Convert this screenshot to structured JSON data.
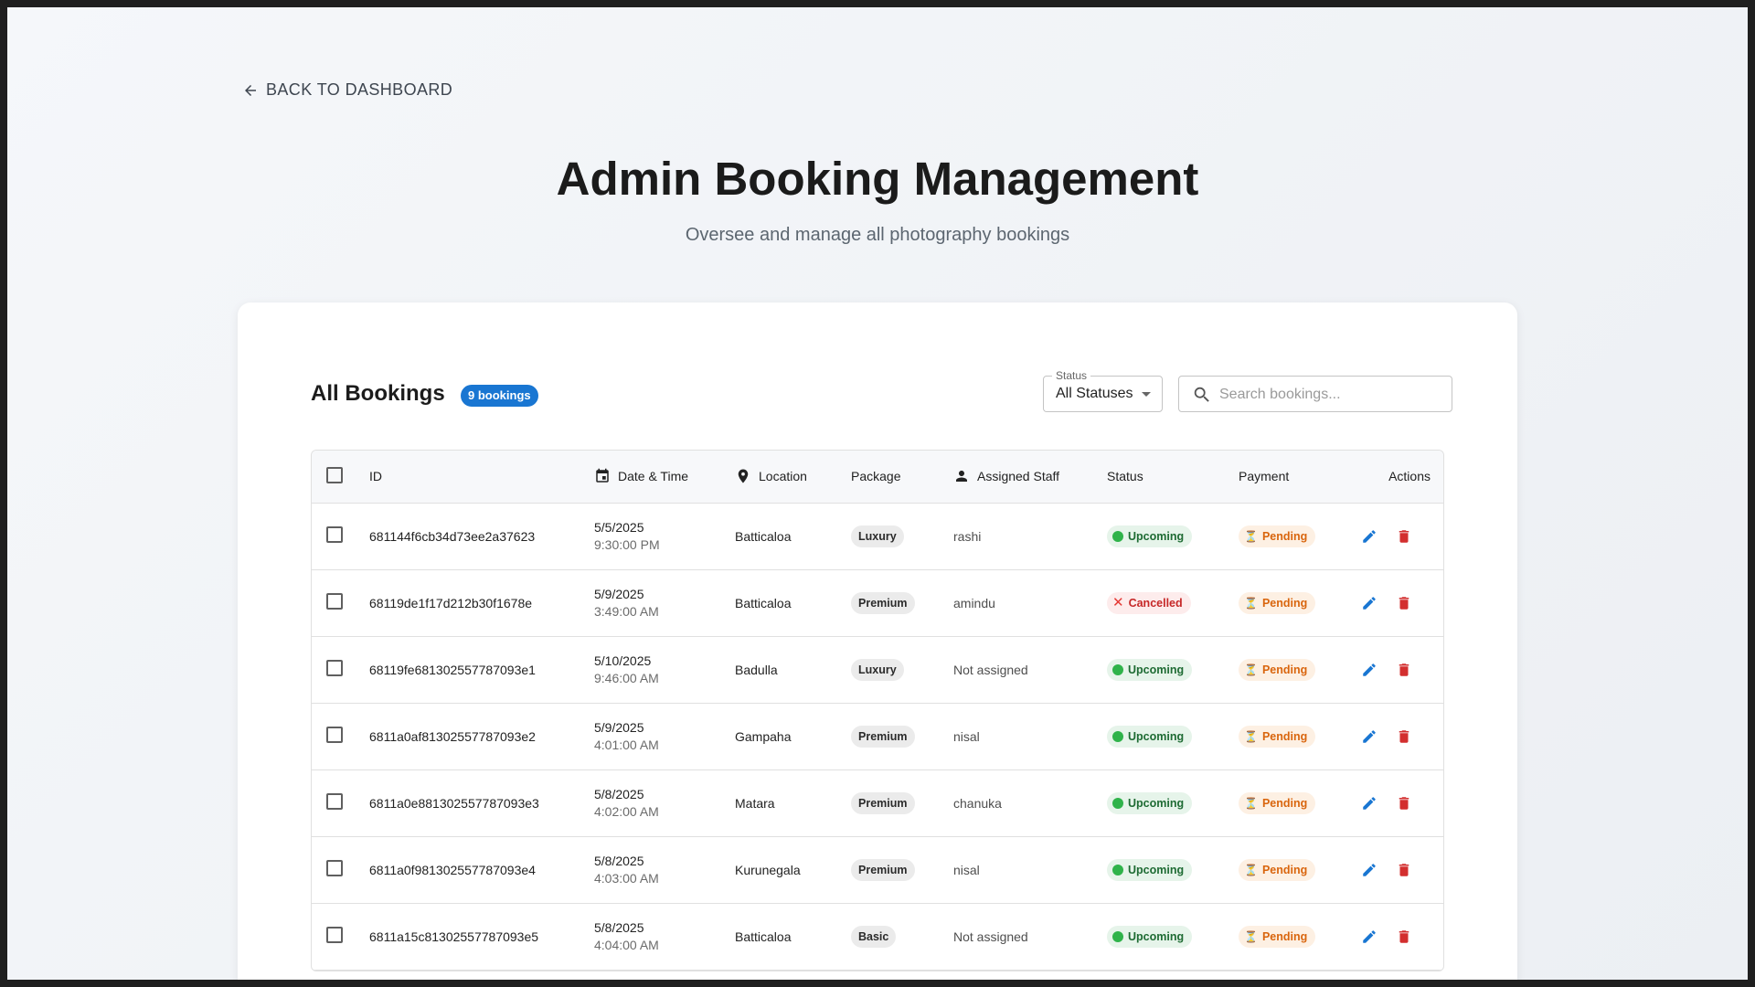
{
  "nav": {
    "back_label": "BACK TO DASHBOARD"
  },
  "header": {
    "title": "Admin Booking Management",
    "subtitle": "Oversee and manage all photography bookings"
  },
  "card": {
    "title": "All Bookings",
    "count_badge": "9 bookings",
    "status_filter": {
      "label": "Status",
      "value": "All Statuses"
    },
    "search": {
      "placeholder": "Search bookings..."
    }
  },
  "table": {
    "columns": {
      "id": "ID",
      "datetime": "Date & Time",
      "location": "Location",
      "package": "Package",
      "staff": "Assigned Staff",
      "status": "Status",
      "payment": "Payment",
      "actions": "Actions"
    },
    "rows": [
      {
        "id": "681144f6cb34d73ee2a37623",
        "date": "5/5/2025",
        "time": "9:30:00 PM",
        "location": "Batticaloa",
        "package": "Luxury",
        "staff": "rashi",
        "status": "Upcoming",
        "status_kind": "upcoming",
        "payment": "Pending"
      },
      {
        "id": "68119de1f17d212b30f1678e",
        "date": "5/9/2025",
        "time": "3:49:00 AM",
        "location": "Batticaloa",
        "package": "Premium",
        "staff": "amindu",
        "status": "Cancelled",
        "status_kind": "cancelled",
        "payment": "Pending"
      },
      {
        "id": "68119fe681302557787093e1",
        "date": "5/10/2025",
        "time": "9:46:00 AM",
        "location": "Badulla",
        "package": "Luxury",
        "staff": "Not assigned",
        "status": "Upcoming",
        "status_kind": "upcoming",
        "payment": "Pending"
      },
      {
        "id": "6811a0af81302557787093e2",
        "date": "5/9/2025",
        "time": "4:01:00 AM",
        "location": "Gampaha",
        "package": "Premium",
        "staff": "nisal",
        "status": "Upcoming",
        "status_kind": "upcoming",
        "payment": "Pending"
      },
      {
        "id": "6811a0e881302557787093e3",
        "date": "5/8/2025",
        "time": "4:02:00 AM",
        "location": "Matara",
        "package": "Premium",
        "staff": "chanuka",
        "status": "Upcoming",
        "status_kind": "upcoming",
        "payment": "Pending"
      },
      {
        "id": "6811a0f981302557787093e4",
        "date": "5/8/2025",
        "time": "4:03:00 AM",
        "location": "Kurunegala",
        "package": "Premium",
        "staff": "nisal",
        "status": "Upcoming",
        "status_kind": "upcoming",
        "payment": "Pending"
      },
      {
        "id": "6811a15c81302557787093e5",
        "date": "5/8/2025",
        "time": "4:04:00 AM",
        "location": "Batticaloa",
        "package": "Basic",
        "staff": "Not assigned",
        "status": "Upcoming",
        "status_kind": "upcoming",
        "payment": "Pending"
      }
    ]
  },
  "colors": {
    "accent": "#1976d2",
    "delete": "#d32f2f",
    "upcoming_bg": "#e6f4ea",
    "cancelled_bg": "#fdecec",
    "pending_bg": "#fdf0e3"
  }
}
